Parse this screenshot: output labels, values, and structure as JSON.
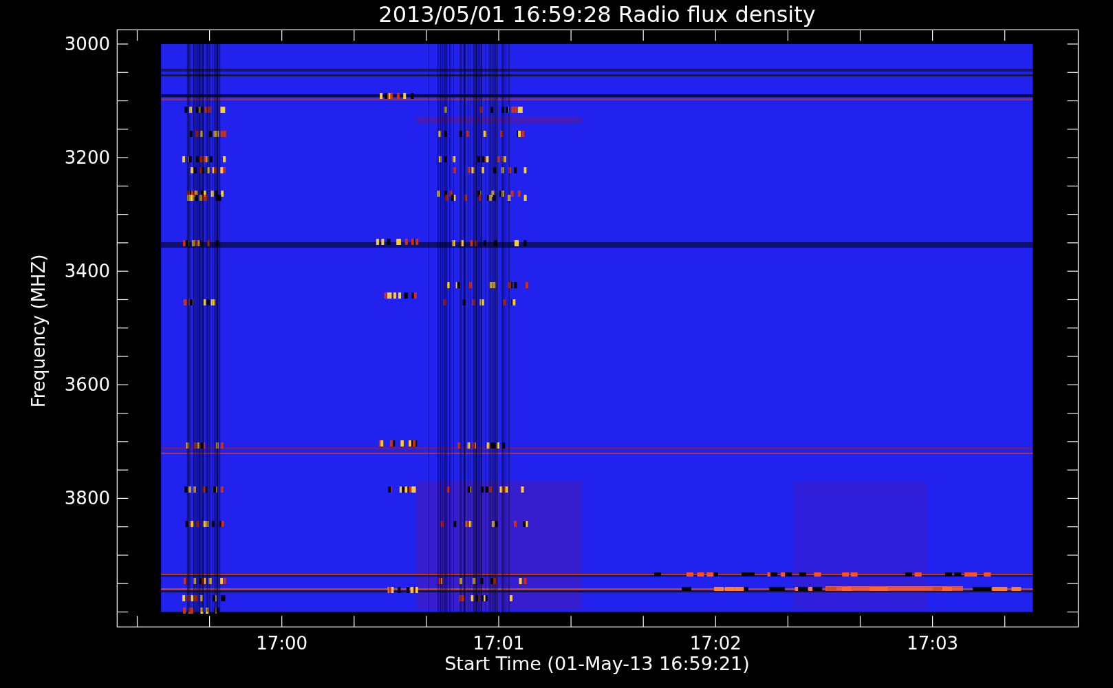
{
  "title": "2013/05/01 16:59:28 Radio flux density",
  "y_axis": {
    "label": "Frequency (MHZ)",
    "ticks": [
      "3000",
      "3200",
      "3400",
      "3600",
      "3800"
    ]
  },
  "x_axis": {
    "label": "Start Time (01-May-13 16:59:21)",
    "ticks": [
      "17:00",
      "17:01",
      "17:02",
      "17:03"
    ]
  }
}
